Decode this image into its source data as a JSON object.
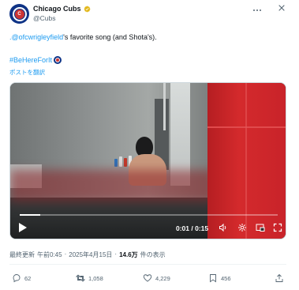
{
  "header": {
    "display_name": "Chicago Cubs",
    "handle": "@Cubs",
    "avatar_initials": "C",
    "more_icon": "more-horizontal-icon",
    "close_icon": "close-icon"
  },
  "tweet": {
    "mention": ".@ofcwrigleyfield",
    "text_after_mention": "'s favorite song (and Shota's).",
    "hashtag": "#BeHereForIt",
    "translate_link": "ポストを翻訳"
  },
  "video": {
    "time": "0:01 / 0:15",
    "progress": 0.08
  },
  "meta": {
    "edited_label": "最終更新",
    "time": "午前0:45",
    "separator": "·",
    "date": "2025年4月15日",
    "views_count": "14.6万",
    "views_label": "件の表示"
  },
  "actions": {
    "replies": "62",
    "reposts": "1,058",
    "likes": "4,229",
    "bookmarks": "456"
  },
  "colors": {
    "link": "#1d9bf0",
    "cubs_blue": "#0e3386",
    "cubs_red": "#cc3433",
    "muted_text": "#536471",
    "verified_gold": "#e2b719"
  }
}
